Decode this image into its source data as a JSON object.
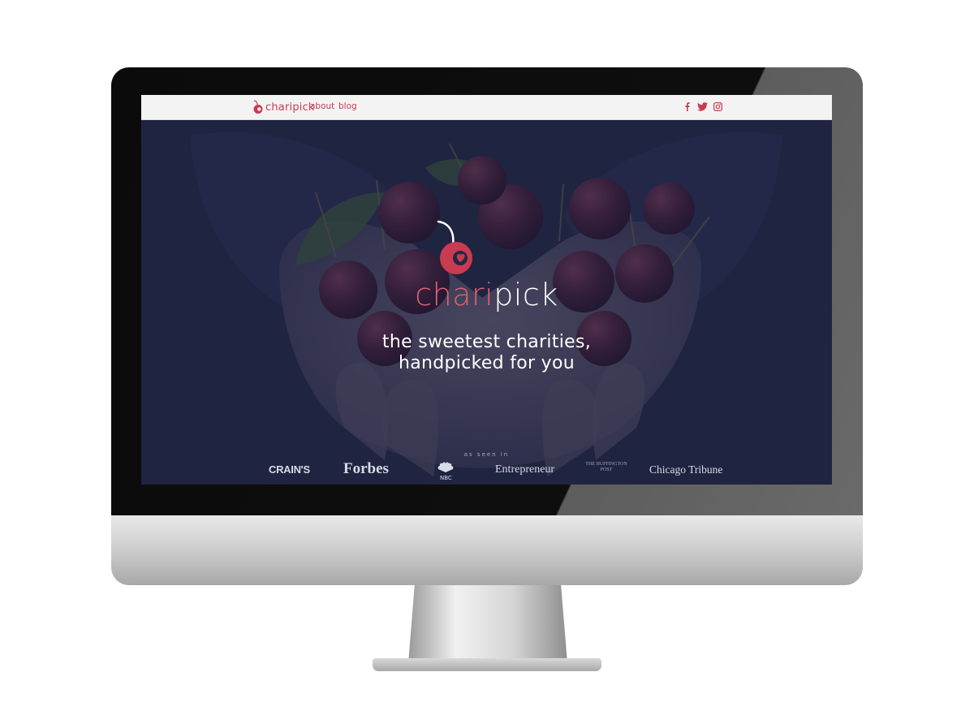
{
  "nav": {
    "logo": {
      "part1": "chari",
      "part2": "pick"
    },
    "links": [
      "about",
      "blog"
    ],
    "social": [
      "facebook-icon",
      "twitter-icon",
      "instagram-icon"
    ]
  },
  "hero": {
    "brand_part1": "chari",
    "brand_part2": "pick",
    "tagline_line1": "the sweetest charities,",
    "tagline_line2": "handpicked for you"
  },
  "press": {
    "heading": "as seen in",
    "logos": [
      "CRAIN'S",
      "Forbes",
      "NBC",
      "Entrepreneur",
      "THE HUFFINGTON POST",
      "Chicago Tribune"
    ]
  },
  "colors": {
    "brand": "#c93b50",
    "hero_overlay": "#1f2440",
    "nav_bg": "#f4f3f3"
  }
}
